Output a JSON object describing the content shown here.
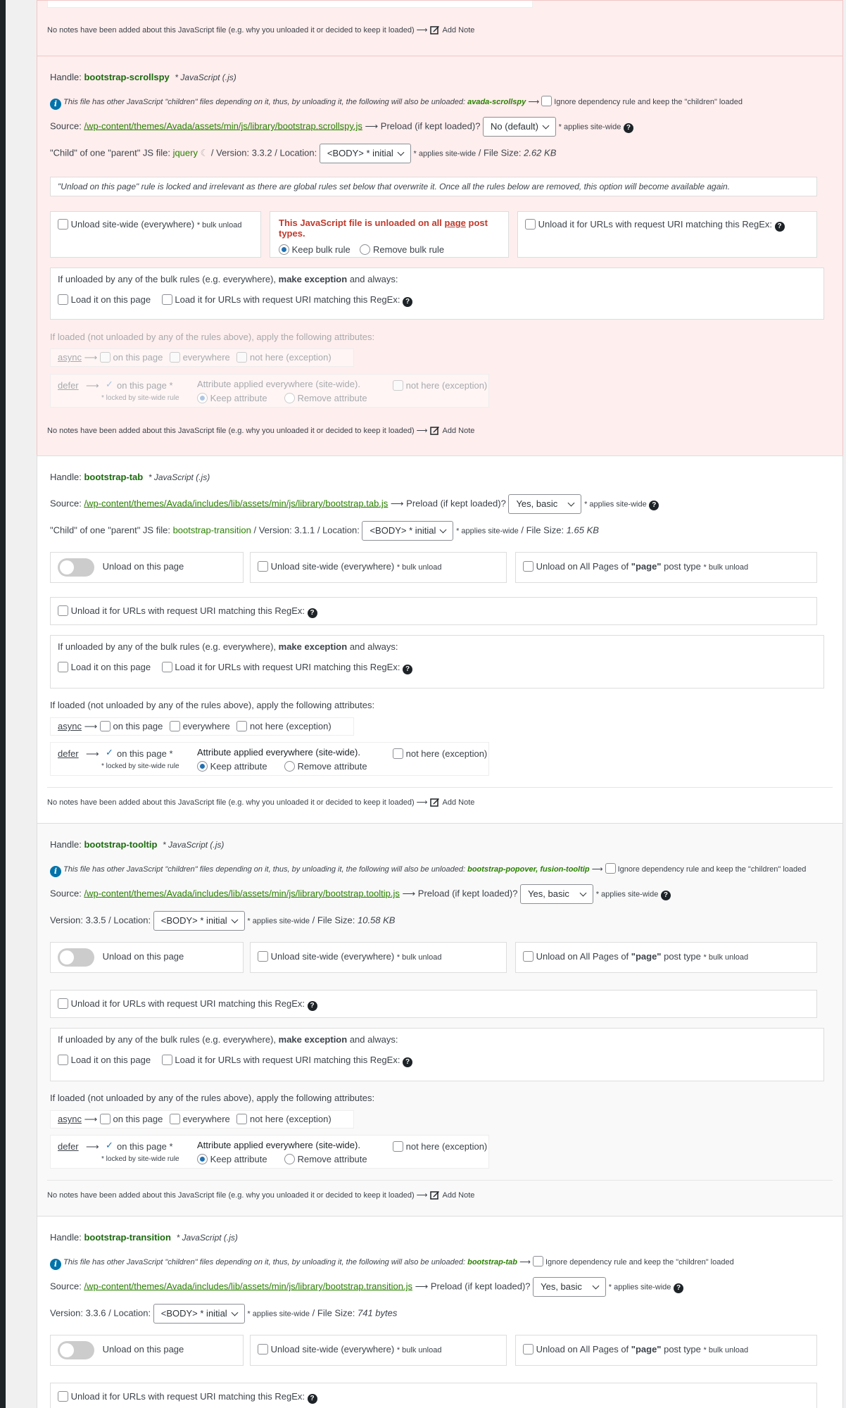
{
  "common": {
    "no_notes": "No notes have been added about this JavaScript file (e.g. why you unloaded it or decided to keep it loaded) ⟶",
    "add_note": "Add Note",
    "handle_label": "Handle:",
    "js_tag": "* JavaScript (.js)",
    "source_label": "Source:",
    "preload_label": "⟶ Preload (if kept loaded)?",
    "applies_site_wide": "* applies site-wide",
    "location_label": "Location:",
    "file_size_label": "File Size:",
    "children_prefix": "This file has other JavaScript \"children\" files depending on it, thus, by unloading it, the following will also be unloaded:",
    "ignore_dep": "Ignore dependency rule and keep the \"children\" loaded",
    "unload_on_page": "Unload on this page",
    "unload_site_wide": "Unload site-wide (everywhere)",
    "bulk_unload": "* bulk unload",
    "unload_all_pages": "Unload on All Pages of",
    "page_word": "\"page\"",
    "post_type": "post type",
    "unload_regex": "Unload it for URLs with request URI matching this RegEx:",
    "exception_text": "If unloaded by any of the bulk rules (e.g. everywhere),",
    "exception_bold": "make exception",
    "exception_end": "and always:",
    "load_on_page": "Load it on this page",
    "load_regex": "Load it for URLs with request URI matching this RegEx:",
    "attrs_title": "If loaded (not unloaded by any of the rules above), apply the following attributes:",
    "async": "async",
    "defer": "defer",
    "arrow": "⟶",
    "on_this_page": "on this page",
    "everywhere": "everywhere",
    "not_here": "not here (exception)",
    "on_this_page_star": "on this page *",
    "locked": "* locked by site-wide rule",
    "attr_applied": "Attribute applied everywhere (site-wide).",
    "keep_attr": "Keep attribute",
    "remove_attr": "Remove attribute"
  },
  "scrollspy": {
    "handle": "bootstrap-scrollspy",
    "children": "avada-scrollspy",
    "source": "/wp-content/themes/Avada/assets/min/js/library/bootstrap.scrollspy.js",
    "preload": "No (default)",
    "parent_text": "\"Child\" of one \"parent\" JS file:",
    "parent": "jquery",
    "version": "Version: 3.3.2",
    "location": "<BODY> * initial",
    "file_size": "2.62 KB",
    "locked_msg": "\"Unload on this page\" rule is locked and irrelevant as there are global rules set below that overwrite it. Once all the rules below are removed, this option will become available again.",
    "unloaded_all_a": "This JavaScript file is unloaded on all",
    "unloaded_all_link": "page",
    "unloaded_all_b": "post types.",
    "keep_bulk": "Keep bulk rule",
    "remove_bulk": "Remove bulk rule"
  },
  "tab": {
    "handle": "bootstrap-tab",
    "source": "/wp-content/themes/Avada/includes/lib/assets/min/js/library/bootstrap.tab.js",
    "preload": "Yes, basic",
    "parent_text": "\"Child\" of one \"parent\" JS file:",
    "parent": "bootstrap-transition",
    "version": "Version: 3.1.1",
    "location": "<BODY> * initial",
    "file_size": "1.65 KB"
  },
  "tooltip": {
    "handle": "bootstrap-tooltip",
    "children": "bootstrap-popover, fusion-tooltip",
    "source": "/wp-content/themes/Avada/includes/lib/assets/min/js/library/bootstrap.tooltip.js",
    "preload": "Yes, basic",
    "version": "Version: 3.3.5",
    "location": "<BODY> * initial",
    "file_size": "10.58 KB"
  },
  "transition": {
    "handle": "bootstrap-transition",
    "children": "bootstrap-tab",
    "source": "/wp-content/themes/Avada/includes/lib/assets/min/js/library/bootstrap.transition.js",
    "preload": "Yes, basic",
    "version": "Version: 3.3.6",
    "location": "<BODY> * initial",
    "file_size": "741 bytes"
  }
}
